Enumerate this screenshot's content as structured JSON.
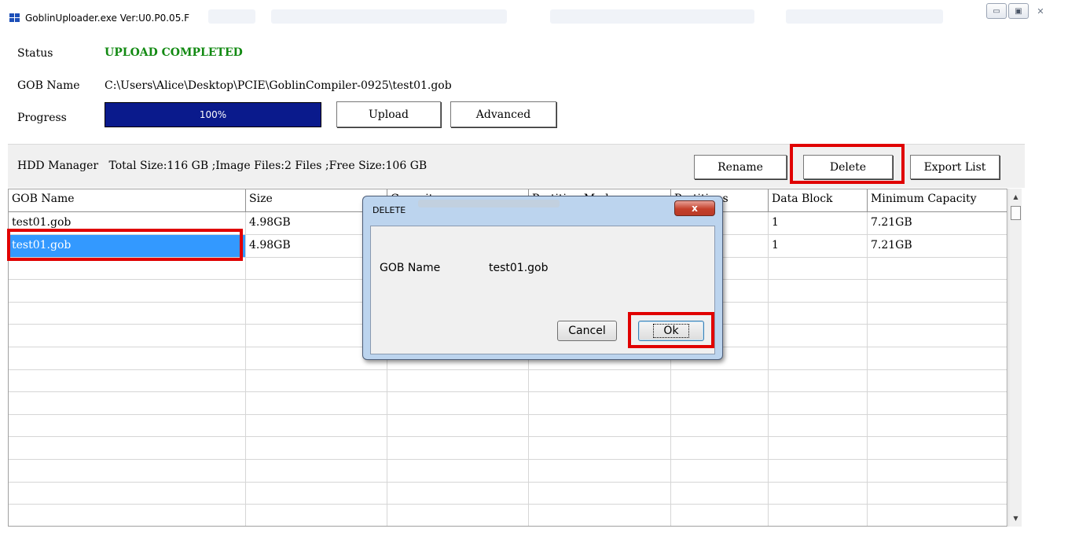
{
  "window": {
    "title": "GoblinUploader.exe Ver:U0.P0.05.F",
    "minimize_glyph": "▭",
    "maximize_glyph": "▣",
    "close_glyph": "✕"
  },
  "status": {
    "label": "Status",
    "value": "UPLOAD COMPLETED",
    "value_color": "#138a13"
  },
  "gob": {
    "label": "GOB Name",
    "path": "C:\\Users\\Alice\\Desktop\\PCIE\\GoblinCompiler-0925\\test01.gob"
  },
  "progress": {
    "label": "Progress",
    "percent": 100,
    "text": "100%",
    "bar_color": "#0a1a8c"
  },
  "actions": {
    "upload": "Upload",
    "advanced": "Advanced"
  },
  "hdd": {
    "info": "HDD Manager   Total Size:116 GB ;Image Files:2 Files ;Free Size:106 GB",
    "rename": "Rename",
    "delete": "Delete",
    "export": "Export List"
  },
  "table": {
    "columns": [
      "GOB Name",
      "Size",
      "Capacity",
      "Partition Mode",
      "Partitions",
      "Data Block",
      "Minimum Capacity"
    ],
    "rows": [
      [
        "test01.gob",
        "4.98GB",
        "",
        "",
        "",
        "1",
        "7.21GB"
      ],
      [
        "test01.gob",
        "4.98GB",
        "",
        "",
        "",
        "1",
        "7.21GB"
      ]
    ],
    "selected_row": 1,
    "selection_color": "#3399ff"
  },
  "dialog": {
    "title": "DELETE",
    "close_glyph": "x",
    "field_label": "GOB Name",
    "field_value": "test01.gob",
    "cancel": "Cancel",
    "ok": "Ok"
  },
  "highlight_color": "#e00000"
}
